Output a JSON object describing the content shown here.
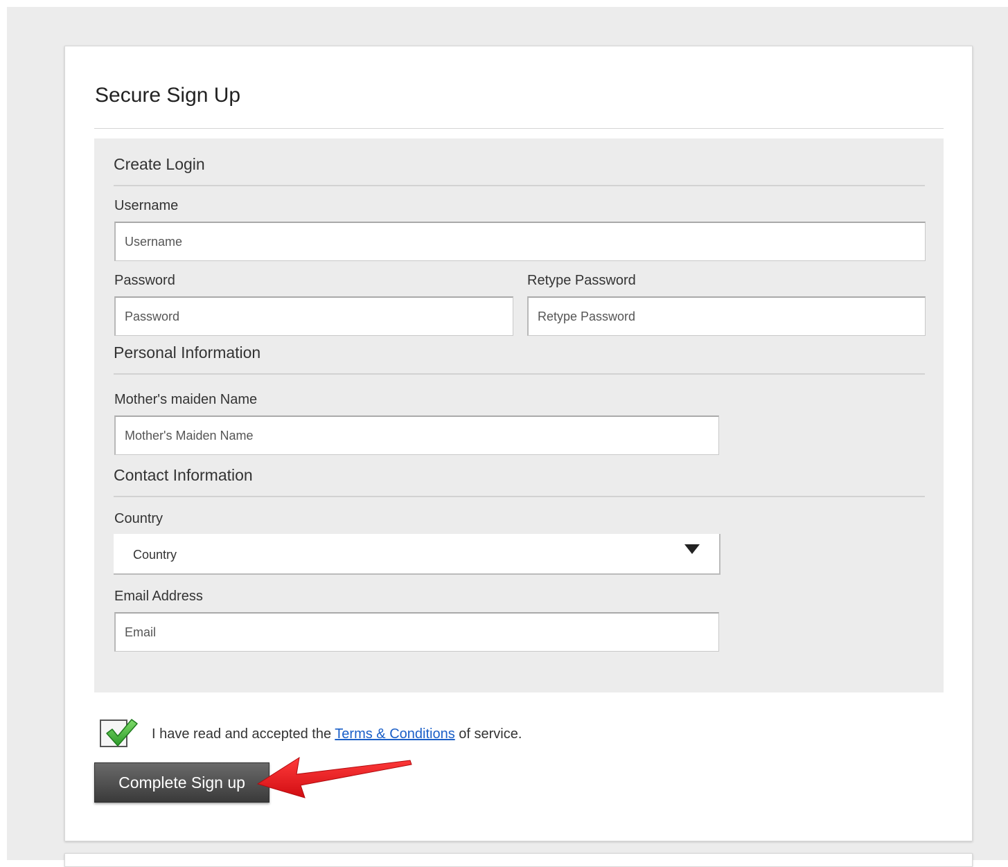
{
  "page": {
    "title": "Secure Sign Up"
  },
  "sections": {
    "login": {
      "title": "Create Login"
    },
    "personal": {
      "title": "Personal Information"
    },
    "contact": {
      "title": "Contact Information"
    }
  },
  "fields": {
    "username": {
      "label": "Username",
      "placeholder": "Username",
      "value": ""
    },
    "password": {
      "label": "Password",
      "placeholder": "Password",
      "value": ""
    },
    "retype_password": {
      "label": "Retype Password",
      "placeholder": "Retype Password",
      "value": ""
    },
    "maiden_name": {
      "label": "Mother's maiden Name",
      "placeholder": "Mother's Maiden Name",
      "value": ""
    },
    "country": {
      "label": "Country",
      "selected": "Country"
    },
    "email": {
      "label": "Email Address",
      "placeholder": "Email",
      "value": ""
    }
  },
  "terms": {
    "checked": true,
    "prefix": "I have read and accepted the",
    "link_text": "Terms & Conditions",
    "suffix": "of service."
  },
  "submit": {
    "label": "Complete Sign up"
  },
  "icons": {
    "checkbox": "green-checkmark-icon",
    "select_caret": "caret-down-icon",
    "annotation": "red-arrow-icon"
  },
  "colors": {
    "page_bg": "#ececec",
    "panel_bg": "#ececec",
    "button_bg": "#4a4a4a",
    "link": "#1a5fc8",
    "check_green": "#3ea83a",
    "arrow_red": "#e8141b"
  }
}
